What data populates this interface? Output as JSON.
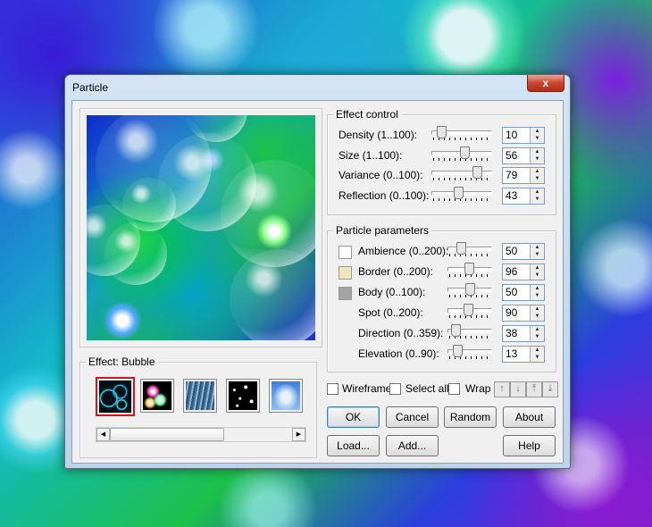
{
  "window": {
    "title": "Particle",
    "close_label": "x"
  },
  "preview": {
    "effect_label": "Effect: Bubble"
  },
  "effect_thumbnails": [
    "bubble",
    "glow-spots",
    "water-streaks",
    "stars",
    "sky"
  ],
  "effect_control": {
    "title": "Effect control",
    "rows": [
      {
        "label": "Density (1..100):",
        "value": "10",
        "level": 10
      },
      {
        "label": "Size (1..100):",
        "value": "56",
        "level": 56
      },
      {
        "label": "Variance (0..100):",
        "value": "79",
        "level": 79
      },
      {
        "label": "Reflection (0..100):",
        "value": "43",
        "level": 43
      }
    ]
  },
  "particle_parameters": {
    "title": "Particle parameters",
    "rows": [
      {
        "label": "Ambience (0..200):",
        "value": "50",
        "level": 25,
        "swatch": "#ffffff"
      },
      {
        "label": "Border (0..200):",
        "value": "96",
        "level": 48,
        "swatch": "#ede6b8"
      },
      {
        "label": "Body (0..100):",
        "value": "50",
        "level": 50,
        "swatch": "#a3a3a3"
      },
      {
        "label": "Spot (0..200):",
        "value": "90",
        "level": 45
      },
      {
        "label": "Direction (0..359):",
        "value": "38",
        "level": 11
      },
      {
        "label": "Elevation (0..90):",
        "value": "13",
        "level": 14
      }
    ]
  },
  "options": {
    "wireframe": "Wireframe",
    "select_all": "Select all",
    "wrap": "Wrap"
  },
  "buttons": {
    "ok": "OK",
    "cancel": "Cancel",
    "random": "Random",
    "about": "About",
    "load": "Load...",
    "add": "Add...",
    "help": "Help"
  },
  "colors": {
    "selected_border": "#d0161a",
    "window_frame": "#bcd3ea"
  }
}
